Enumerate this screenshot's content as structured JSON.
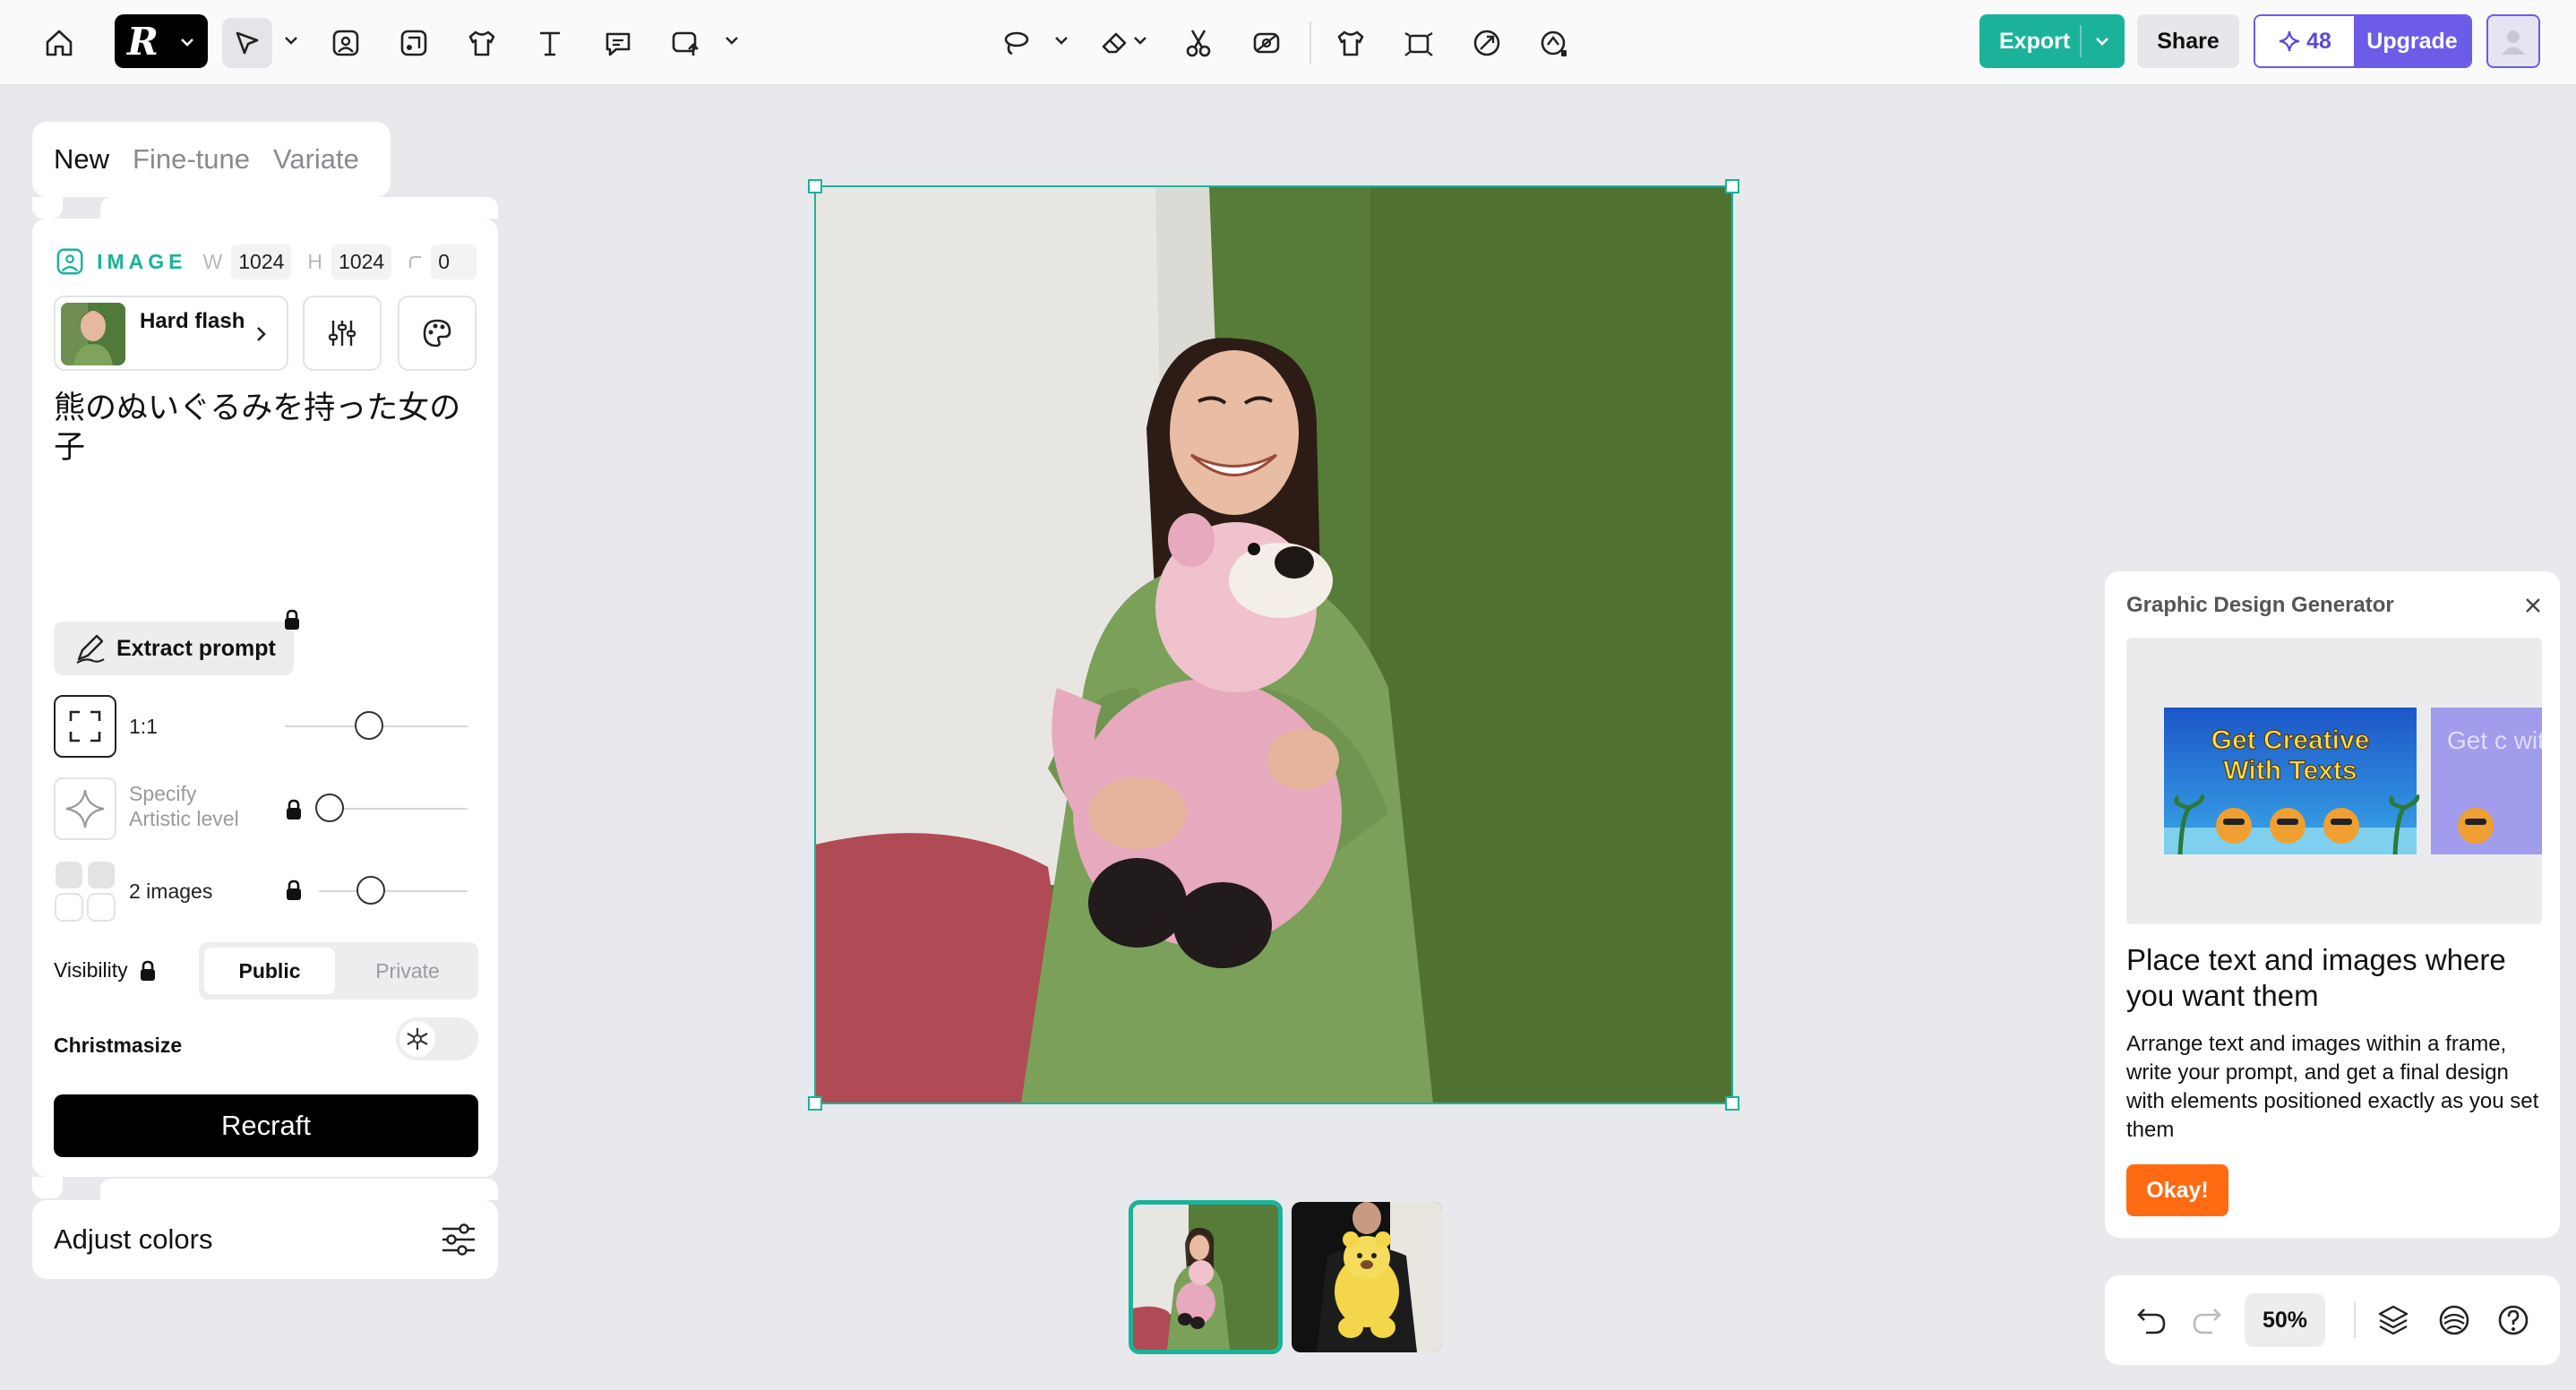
{
  "toolbar": {
    "export_label": "Export",
    "share_label": "Share",
    "credits": "48",
    "upgrade_label": "Upgrade"
  },
  "mode_tabs": [
    {
      "label": "New",
      "active": true
    },
    {
      "label": "Fine-tune",
      "active": false
    },
    {
      "label": "Variate",
      "active": false
    }
  ],
  "image_settings": {
    "label": "IMAGE",
    "width_key": "W",
    "width": "1024",
    "height_key": "H",
    "height": "1024",
    "seed": "0"
  },
  "style": {
    "name": "Hard flash"
  },
  "prompt": "熊のぬいぐるみを持った女の子",
  "extract_prompt_label": "Extract prompt",
  "controls": {
    "aspect_ratio": "1:1",
    "artistic_level_label": "Specify Artistic level",
    "images_count_label": "2 images",
    "visibility_label": "Visibility",
    "visibility_options": [
      "Public",
      "Private"
    ],
    "visibility_selected": "Public",
    "christmasize_label": "Christmasize",
    "recraft_label": "Recraft"
  },
  "adjust_colors_label": "Adjust colors",
  "popover": {
    "title": "Graphic Design Generator",
    "preview_text_1": "Get Creative With Texts",
    "preview_text_2": "Get c with",
    "heading": "Place text and images where you want them",
    "body": "Arrange text and images within a frame, write your prompt, and get a final design with elements positioned exactly as you set them",
    "ok_label": "Okay!"
  },
  "bottom_toolbar": {
    "zoom": "50%"
  },
  "colors": {
    "accent": "#1ab39a",
    "upgrade": "#6c5ce7",
    "ok_button": "#ff6b12"
  }
}
